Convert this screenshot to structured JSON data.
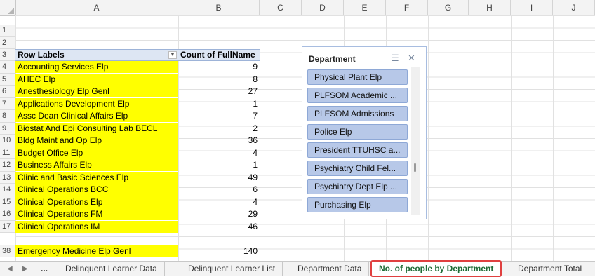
{
  "columns": [
    "A",
    "B",
    "C",
    "D",
    "E",
    "F",
    "G",
    "H",
    "I",
    "J"
  ],
  "row_numbers": [
    "1",
    "2",
    "3",
    "4",
    "5",
    "6",
    "7",
    "8",
    "9",
    "10",
    "11",
    "12",
    "13",
    "14",
    "15",
    "16",
    "17",
    "38"
  ],
  "pivot": {
    "row_labels_header": "Row Labels",
    "filter_icon": "filter-dropdown-icon",
    "value_header": "Count of FullName",
    "rows": [
      {
        "label": "Accounting Services Elp",
        "count": "9"
      },
      {
        "label": "AHEC Elp",
        "count": "8"
      },
      {
        "label": "Anesthesiology Elp Genl",
        "count": "27"
      },
      {
        "label": "Applications Development Elp",
        "count": "1"
      },
      {
        "label": "Assc Dean Clinical Affairs Elp",
        "count": "7"
      },
      {
        "label": "Biostat And Epi Consulting Lab BECL",
        "count": "2"
      },
      {
        "label": "Bldg Maint and Op Elp",
        "count": "36"
      },
      {
        "label": "Budget Office Elp",
        "count": "4"
      },
      {
        "label": "Business Affairs Elp",
        "count": "1"
      },
      {
        "label": "Clinic and Basic Sciences Elp",
        "count": "49"
      },
      {
        "label": "Clinical Operations BCC",
        "count": "6"
      },
      {
        "label": "Clinical Operations Elp",
        "count": "4"
      },
      {
        "label": "Clinical Operations FM",
        "count": "29"
      },
      {
        "label": "Clinical Operations IM",
        "count": "46"
      },
      {
        "label": "Emergency Medicine Elp Genl",
        "count": "140"
      }
    ]
  },
  "slicer": {
    "title": "Department",
    "multi_select_icon": "multi-select-icon",
    "clear_filter_icon": "clear-filter-icon",
    "items": [
      "Physical Plant Elp",
      "PLFSOM Academic ...",
      "PLFSOM Admissions",
      "Police Elp",
      "President TTUHSC a...",
      "Psychiatry Child Fel...",
      "Psychiatry Dept Elp ...",
      "Purchasing Elp"
    ]
  },
  "tabs": {
    "ellipsis": "...",
    "items": [
      "Delinquent Learner Data",
      "Delinquent Learner List",
      "Department Data",
      "No. of people by Department",
      "Department Total"
    ],
    "active_index": 3,
    "active_outline_color": "#e04040"
  },
  "colors": {
    "highlight": "#ffff00",
    "pivot_header": "#dde6f3",
    "slicer_item": "#b7c8e8"
  }
}
